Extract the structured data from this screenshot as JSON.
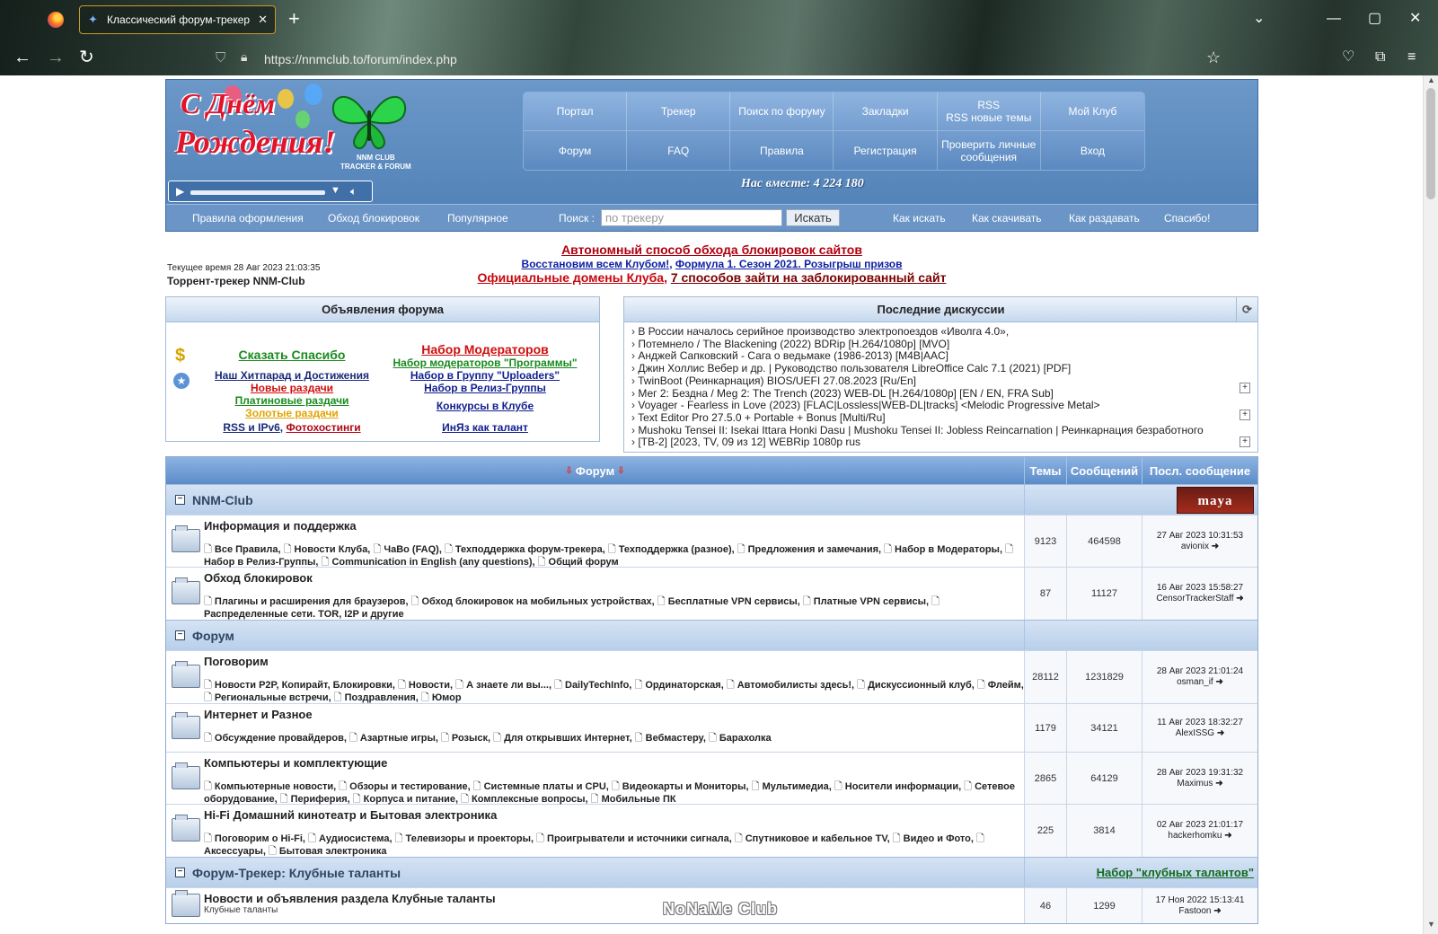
{
  "browser": {
    "tab_title": "Классический форум-трекер",
    "url": "https://nnmclub.to/forum/index.php"
  },
  "header": {
    "logo_line1": "С Днём",
    "logo_line2": "Рождения!",
    "logo_club": "NNM CLUB",
    "logo_tracker": "TRACKER & FORUM",
    "menu": [
      {
        "label": "Портал"
      },
      {
        "label": "Трекер"
      },
      {
        "label": "Поиск по форуму"
      },
      {
        "label": "Закладки"
      },
      {
        "label": "RSS\nRSS новые темы"
      },
      {
        "label": "Мой Клуб"
      },
      {
        "label": "Форум"
      },
      {
        "label": "FAQ"
      },
      {
        "label": "Правила"
      },
      {
        "label": "Регистрация"
      },
      {
        "label": "Проверить личные сообщения"
      },
      {
        "label": "Вход"
      }
    ],
    "together": "Нас вместе: 4 224 180"
  },
  "subbar": {
    "left_links": [
      "Правила оформления",
      "Обход блокировок",
      "Популярное"
    ],
    "search_label": "Поиск :",
    "search_placeholder": "по трекеру",
    "search_button": "Искать",
    "right_links": [
      "Как искать",
      "Как скачивать",
      "Как раздавать",
      "Спасибо!"
    ]
  },
  "info": {
    "current_time": "Текущее время 28 Авг 2023 21:03:35",
    "site_title": "Торрент-трекер NNM-Club",
    "ann1": "Автономный способ обхода блокировок сайтов",
    "ann2a": "Восстановим всем Клубом!",
    "ann2b": "Формула 1. Сезон 2021. Розыгрыш призов",
    "ann3a": "Официальные домены Клуба",
    "ann3b": "7 способов зайти на заблокированный сайт"
  },
  "announcements": {
    "title": "Объявления форума",
    "left": [
      "Сказать Спасибо",
      "Наш Хитпарад и Достижения",
      "Новые раздачи",
      "Платиновые раздачи",
      "Золотые раздачи",
      "RSS и IPv6",
      "Фотохостинги"
    ],
    "right": [
      "Набор Модераторов",
      "Набор модераторов \"Программы\"",
      "Набор в Группу \"Uploaders\"",
      "Набор в Релиз-Группы",
      "Конкурсы в Клубе",
      "ИнЯз как талант"
    ]
  },
  "discussions": {
    "title": "Последние дискуссии",
    "items": [
      "В России началось серийное производство электропоездов «Иволга 4.0»,",
      "Потемнело / The Blackening (2022) BDRip [H.264/1080p] [MVO]",
      "Анджей Сапковский - Сага о ведьмаке (1986-2013) [M4B|AAC]",
      "Джин Холлис Вебер и др. | Руководство пользователя LibreOffice Calc 7.1 (2021) [PDF]",
      "TwinBoot (Реинкарнация) BIOS/UEFI 27.08.2023 [Ru/En]",
      "Мег 2: Бездна / Meg 2: The Trench (2023) WEB-DL [H.264/1080p] [EN / EN, FRA Sub]",
      "Voyager - Fearless in Love (2023) [FLAC|Lossless|WEB-DL|tracks] <Melodic Progressive Metal>",
      "Text Editor Pro 27.5.0 + Portable + Bonus [Multi/Ru]",
      "Mushoku Tensei II: Isekai Ittara Honki Dasu | Mushoku Tensei II: Jobless Reincarnation | Реинкарнация безработного",
      "[TB-2] [2023, TV, 09 из 12] WEBRip 1080p rus"
    ]
  },
  "forum": {
    "headers": {
      "forum": "Форум",
      "topics": "Темы",
      "posts": "Сообщений",
      "last": "Посл. сообщение"
    },
    "categories": [
      {
        "name": "NNM-Club",
        "right": "maya",
        "forums": [
          {
            "name": "Информация и поддержка",
            "subs": [
              "Все Правила,",
              "Новости Клуба,",
              "ЧаВо (FAQ),",
              "Техподдержка форум-трекера,",
              "Техподдержка (разное),",
              "Предложения и замечания,",
              "Набор в Модераторы,",
              "Набор в Релиз-Группы,",
              "Communication in English (any questions),",
              "Общий форум"
            ],
            "topics": "9123",
            "posts": "464598",
            "last_date": "27 Авг 2023 10:31:53",
            "last_user": "avionix"
          },
          {
            "name": "Обход блокировок",
            "subs": [
              "Плагины и расширения для браузеров,",
              "Обход блокировок на мобильных устройствах,",
              "Бесплатные VPN сервисы,",
              "Платные VPN сервисы,",
              "Распределенные сети. TOR, I2P и другие"
            ],
            "topics": "87",
            "posts": "11127",
            "last_date": "16 Авг 2023 15:58:27",
            "last_user": "CensorTrackerStaff"
          }
        ]
      },
      {
        "name": "Форум",
        "right": "",
        "forums": [
          {
            "name": "Поговорим",
            "subs": [
              "Новости P2P, Копирайт, Блокировки,",
              "Новости,",
              "А знаете ли вы...,",
              "DailyTechInfo,",
              "Ординаторская,",
              "Автомобилисты здесь!,",
              "Дискуссионный клуб,",
              "Флейм,",
              "Региональные встречи,",
              "Поздравления,",
              "Юмор"
            ],
            "topics": "28112",
            "posts": "1231829",
            "last_date": "28 Авг 2023 21:01:24",
            "last_user": "osman_if"
          },
          {
            "name": "Интернет и Разное",
            "subs": [
              "Обсуждение провайдеров,",
              "Азартные игры,",
              "Розыск,",
              "Для открывших Интернет,",
              "Вебмастеру,",
              "Барахолка"
            ],
            "topics": "1179",
            "posts": "34121",
            "last_date": "11 Авг 2023 18:32:27",
            "last_user": "AlexISSG"
          },
          {
            "name": "Компьютеры и комплектующие",
            "subs": [
              "Компьютерные новости,",
              "Обзоры и тестирование,",
              "Системные платы и CPU,",
              "Видеокарты и Мониторы,",
              "Мультимедиа,",
              "Носители информации,",
              "Сетевое оборудование,",
              "Периферия,",
              "Корпуса и питание,",
              "Комплексные вопросы,",
              "Мобильные ПК"
            ],
            "topics": "2865",
            "posts": "64129",
            "last_date": "28 Авг 2023 19:31:32",
            "last_user": "Maximus"
          },
          {
            "name": "Hi-Fi Домашний кинотеатр и Бытовая электроника",
            "subs": [
              "Поговорим о Hi-Fi,",
              "Аудиосистема,",
              "Телевизоры и проекторы,",
              "Проигрыватели и источники сигнала,",
              "Спутниковое и кабельное TV,",
              "Видео и Фото,",
              "Аксессуары,",
              "Бытовая электроника"
            ],
            "topics": "225",
            "posts": "3814",
            "last_date": "02 Авг 2023 21:01:17",
            "last_user": "hackerhomku"
          }
        ]
      },
      {
        "name": "Форум-Трекер: Клубные таланты",
        "right": "Набор \"клубных талантов\"",
        "forums": [
          {
            "name": "Новости и объявления раздела Клубные таланты",
            "small": "Клубные таланты",
            "subs": [],
            "topics": "46",
            "posts": "1299",
            "last_date": "17 Ноя 2022 15:13:41",
            "last_user": "Fastoon"
          }
        ]
      }
    ]
  },
  "maya_text": "maya",
  "watermark": "NoNaMe Club"
}
